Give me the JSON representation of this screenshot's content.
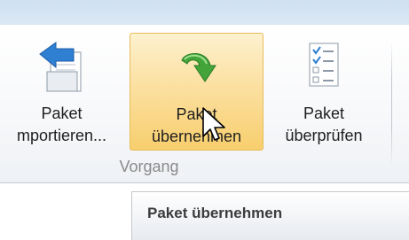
{
  "ribbon": {
    "buttons": [
      {
        "line1": "Paket",
        "line2": "mportieren...",
        "icon": "import-arrow-icon"
      },
      {
        "line1": "Paket",
        "line2": "übernehmen",
        "icon": "green-curved-arrow-icon"
      },
      {
        "line1": "Paket",
        "line2": "überprüfen",
        "icon": "checklist-icon"
      }
    ],
    "group_label": "Vorgang"
  },
  "tooltip": {
    "title": "Paket übernehmen"
  },
  "colors": {
    "hover_fill": "#f8cf6e",
    "hover_border": "#e8bd5a",
    "import_arrow": "#2f7fd2",
    "accept_arrow": "#43a43a"
  }
}
